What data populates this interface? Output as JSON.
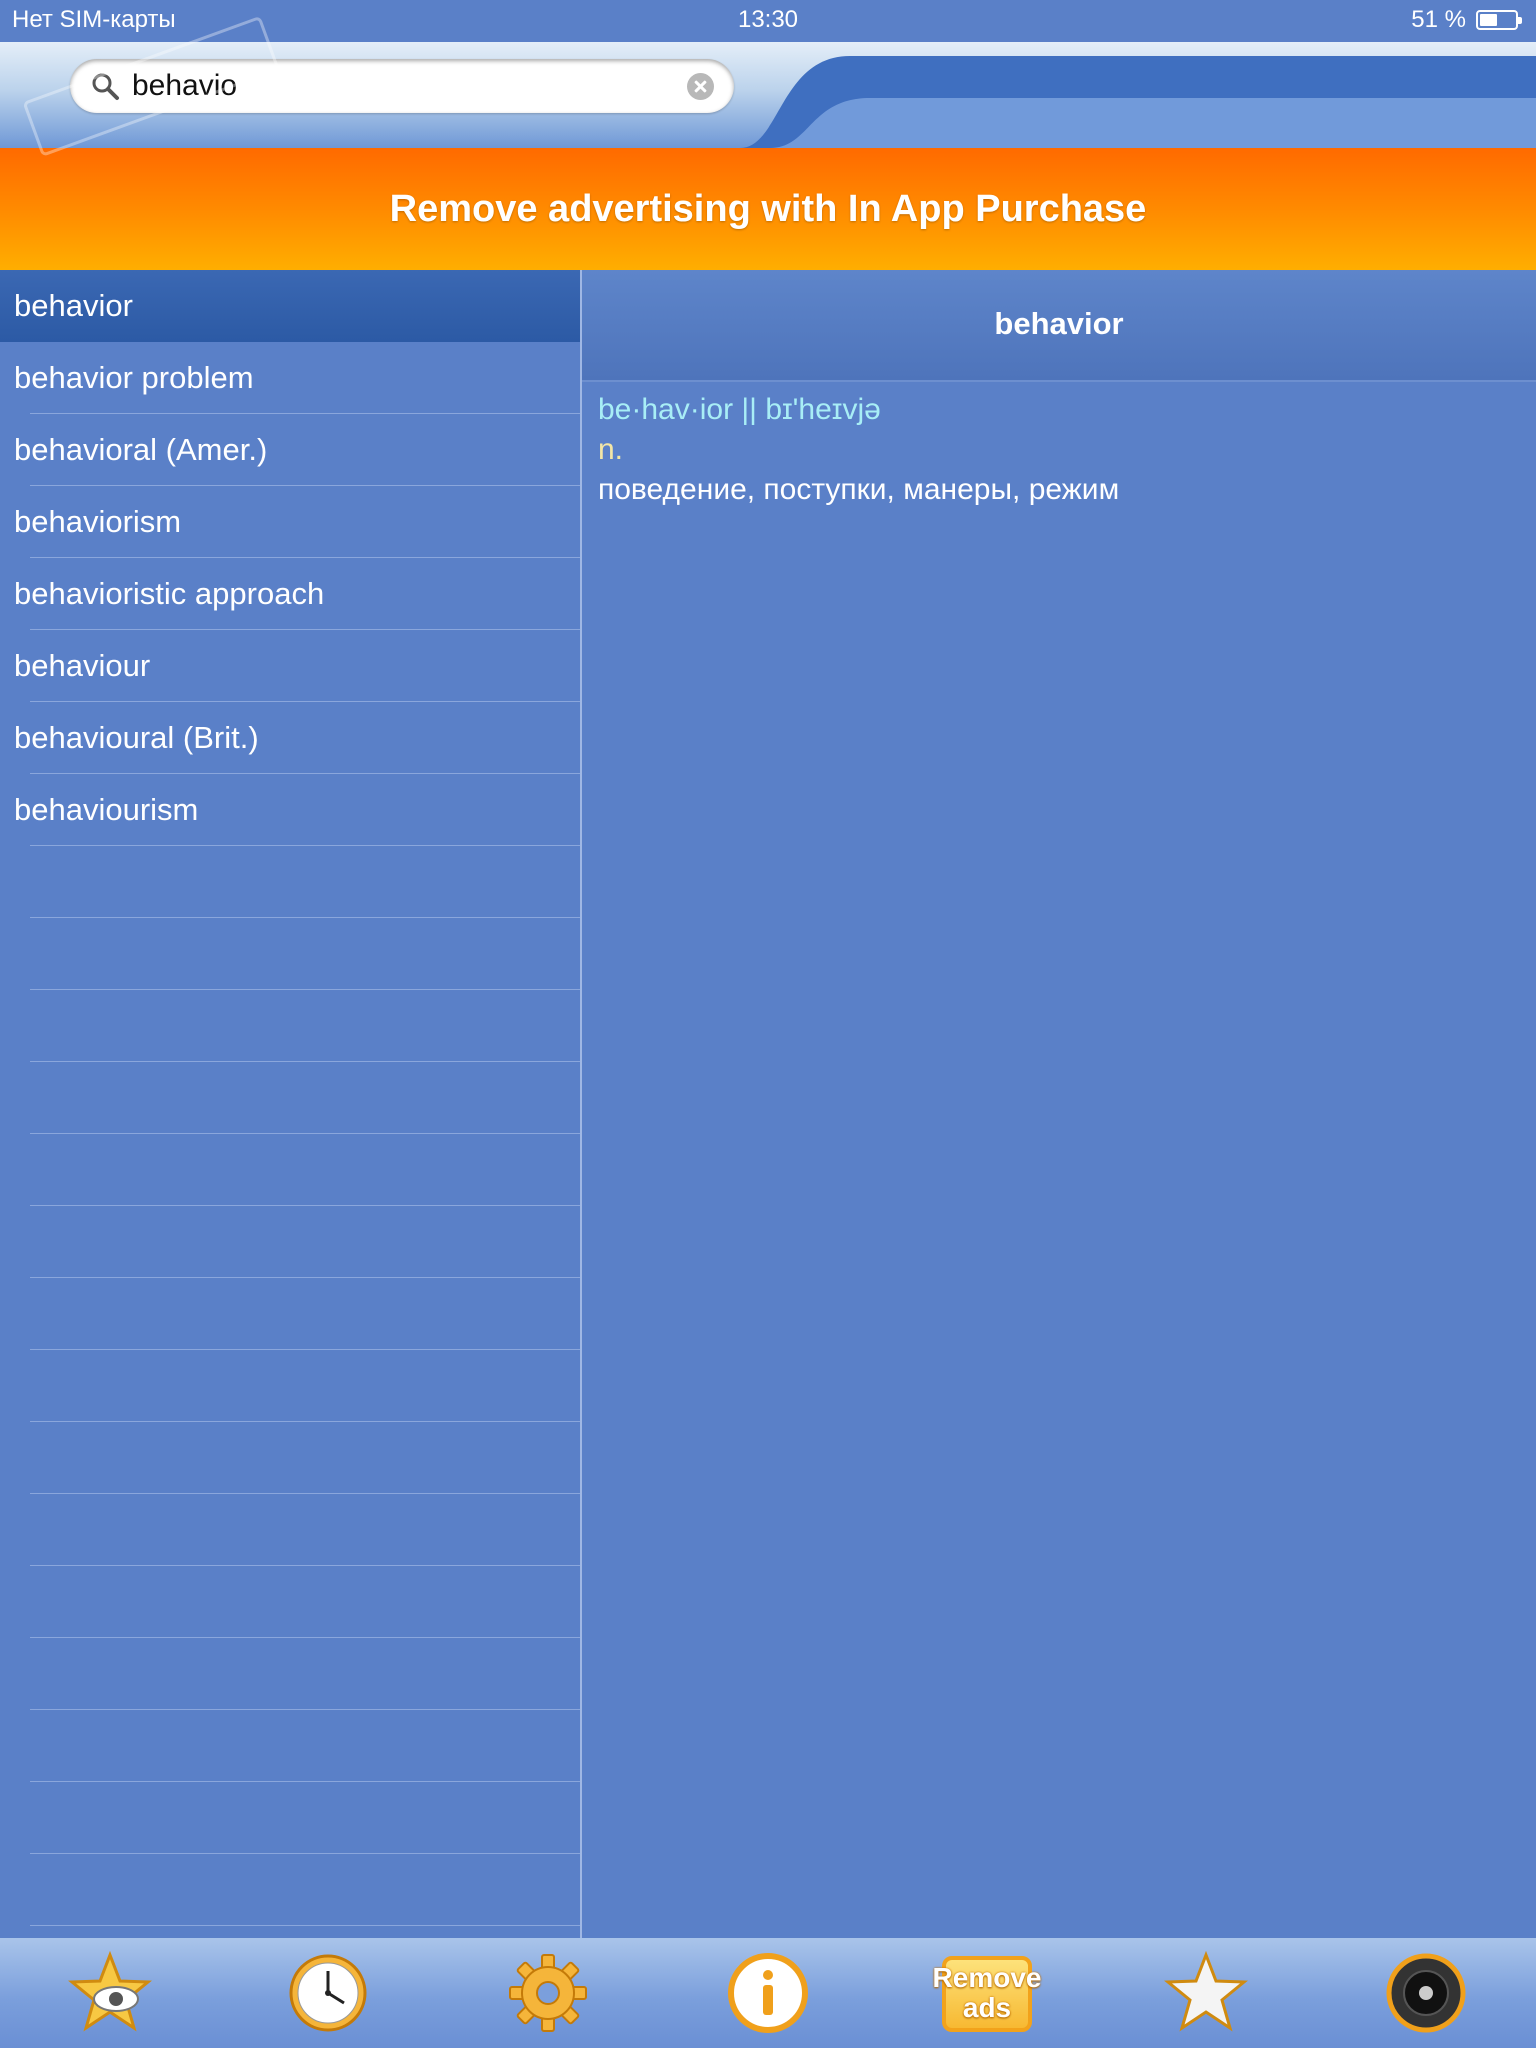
{
  "status_bar": {
    "carrier": "Нет SIM-карты",
    "time": "13:30",
    "battery": "51 %",
    "battery_level": 0.51
  },
  "search": {
    "value": "behavio"
  },
  "ad_banner": {
    "text": "Remove advertising with In App Purchase"
  },
  "word_list": {
    "items": [
      {
        "label": "behavior",
        "selected": true
      },
      {
        "label": "behavior problem"
      },
      {
        "label": "behavioral (Amer.)"
      },
      {
        "label": "behaviorism"
      },
      {
        "label": "behavioristic approach"
      },
      {
        "label": "behaviour"
      },
      {
        "label": "behavioural (Brit.)"
      },
      {
        "label": "behaviourism"
      }
    ],
    "empty_rows": 16
  },
  "entry": {
    "title": "behavior",
    "pronunciation": "be·hav·ior || bɪ'heɪvjə",
    "part_of_speech": "n.",
    "translation": "поведение, поступки, манеры, режим"
  },
  "toolbar": {
    "buttons": [
      {
        "name": "favorites-view",
        "icon": "star-eye-icon"
      },
      {
        "name": "history",
        "icon": "clock-icon"
      },
      {
        "name": "settings",
        "icon": "gear-icon"
      },
      {
        "name": "info",
        "icon": "info-icon"
      },
      {
        "name": "remove-ads",
        "icon": "remove-ads-icon",
        "label_line1": "Remove",
        "label_line2": "ads"
      },
      {
        "name": "add-favorite",
        "icon": "star-icon"
      },
      {
        "name": "sound",
        "icon": "speaker-icon"
      }
    ]
  },
  "colors": {
    "background": "#5a80c8",
    "selected_row": "#2f5ca8",
    "banner_orange": "#ff7a00",
    "pronunciation": "#a8eef6",
    "part_of_speech": "#f3e6a6"
  }
}
